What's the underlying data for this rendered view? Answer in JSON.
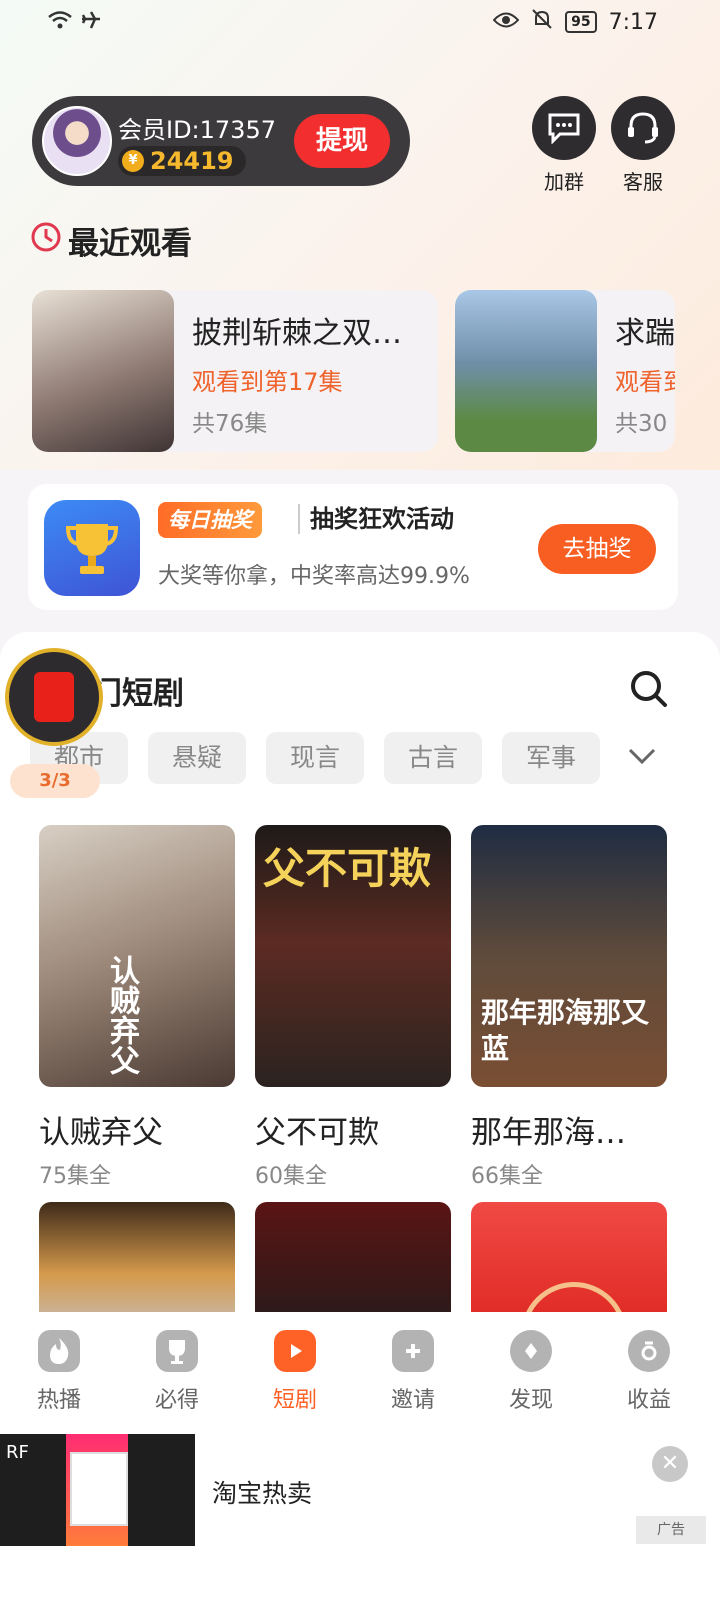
{
  "status_bar": {
    "battery": "95",
    "time": "7:17"
  },
  "member": {
    "id_label": "会员ID:17357",
    "coins": "24419",
    "coin_symbol": "¥",
    "withdraw_label": "提现"
  },
  "top_actions": {
    "group_label": "加群",
    "service_label": "客服"
  },
  "recent": {
    "title": "最近观看",
    "items": [
      {
        "title": "披荆斩棘之双…",
        "progress": "观看到第17集",
        "count": "共76集"
      },
      {
        "title": "求踹",
        "progress": "观看到",
        "count": "共30"
      }
    ]
  },
  "lottery": {
    "tag": "每日抽奖",
    "title": "抽奖狂欢活动",
    "subtitle": "大奖等你拿，中奖率高达99.9%",
    "button": "去抽奖"
  },
  "float_packet": {
    "progress": "3/3"
  },
  "hot": {
    "title": "热门短剧",
    "categories": [
      "都市",
      "悬疑",
      "现言",
      "古言",
      "军事"
    ],
    "dramas": [
      {
        "name": "认贼弃父",
        "episodes": "75集全",
        "poster_text": "认贼弃父"
      },
      {
        "name": "父不可欺",
        "episodes": "60集全",
        "poster_text": "父不可欺"
      },
      {
        "name": "那年那海…",
        "episodes": "66集全",
        "poster_text": "那年那海那又蓝"
      }
    ]
  },
  "tabs": [
    {
      "label": "热播",
      "icon": "flame-icon"
    },
    {
      "label": "必得",
      "icon": "trophy-icon"
    },
    {
      "label": "短剧",
      "icon": "play-icon"
    },
    {
      "label": "邀请",
      "icon": "invite-icon"
    },
    {
      "label": "发现",
      "icon": "discover-icon"
    },
    {
      "label": "收益",
      "icon": "money-bag-icon"
    }
  ],
  "active_tab": "短剧",
  "ad": {
    "corner": "RF",
    "title": "淘宝热卖",
    "tag": "广告"
  },
  "colors": {
    "accent": "#ff6226",
    "withdraw_red": "#f22e2e",
    "coin_gold": "#f6b92e",
    "dark_card": "#3c3a3d"
  }
}
